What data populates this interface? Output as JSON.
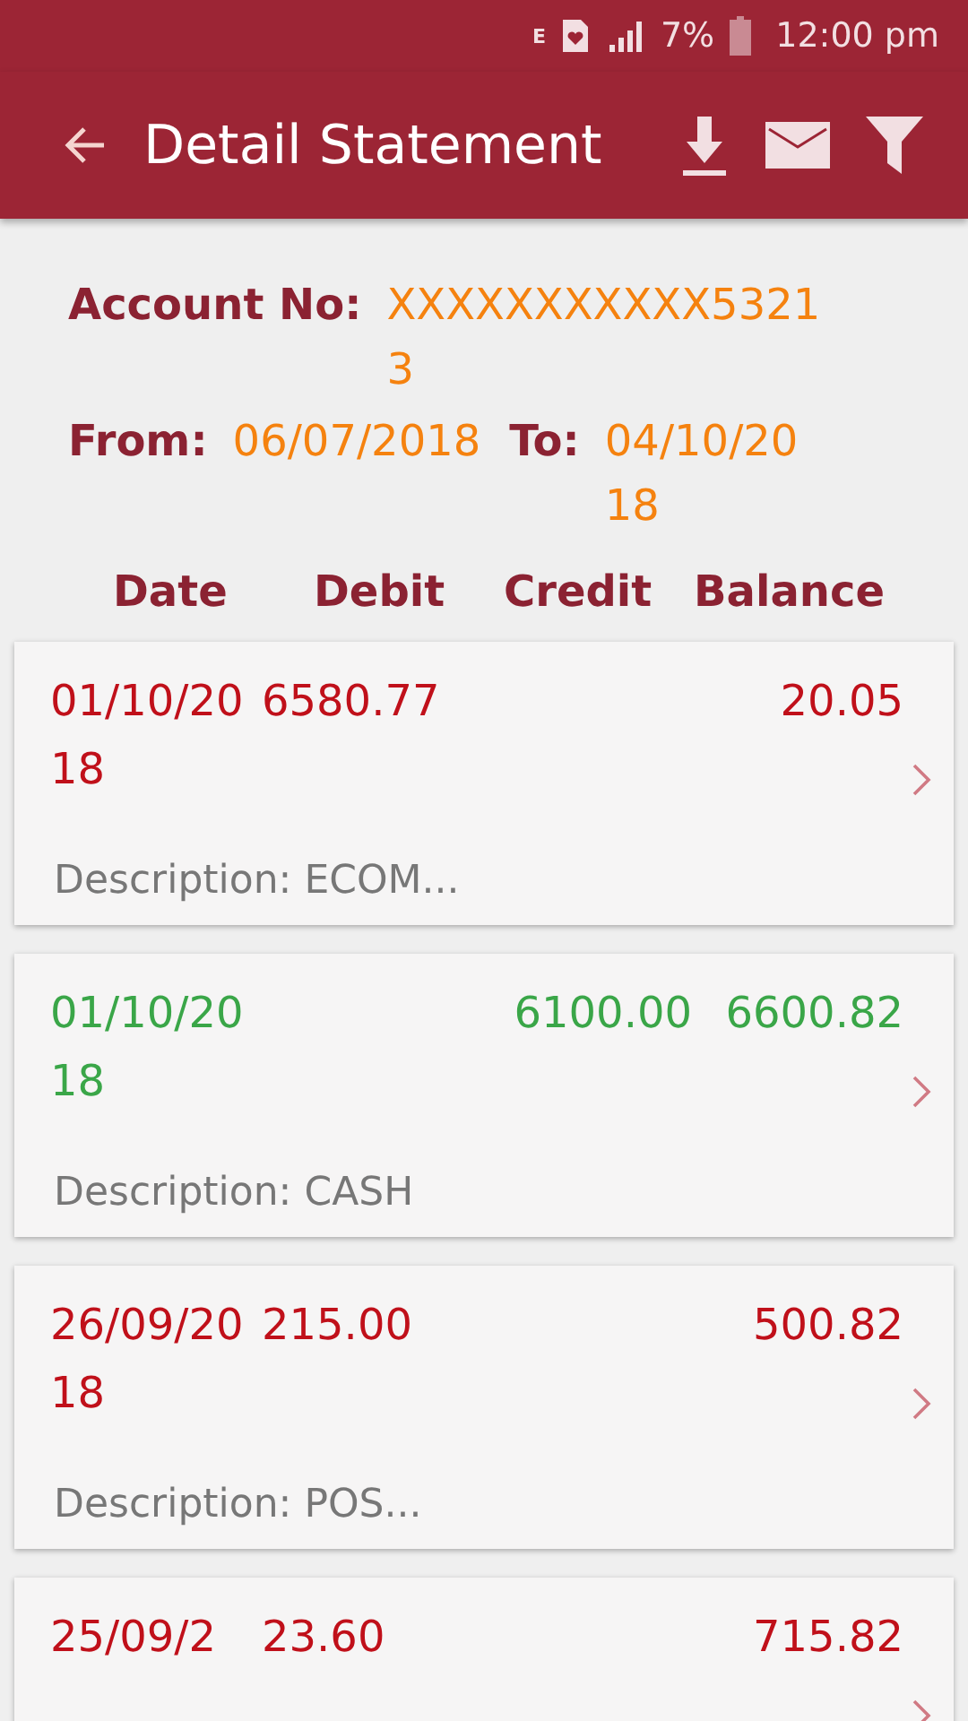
{
  "status_bar": {
    "network": "E",
    "battery": "7%",
    "time": "12:00 pm"
  },
  "app_bar": {
    "title": "Detail Statement"
  },
  "account": {
    "label": "Account No:",
    "value": "XXXXXXXXXXX53213"
  },
  "period": {
    "from_label": "From:",
    "from": "06/07/2018",
    "to_label": "To:",
    "to": "04/10/2018"
  },
  "columns": [
    "Date",
    "Debit",
    "Credit",
    "Balance"
  ],
  "transactions": [
    {
      "kind": "debit",
      "date": "01/10/2018",
      "debit": "6580.77",
      "balance": "20.05",
      "description": "Description: ECOM..."
    },
    {
      "kind": "credit",
      "date": "01/10/2018",
      "credit": "6100.00",
      "balance": "6600.82",
      "description": "Description: CASH"
    },
    {
      "kind": "debit",
      "date": "26/09/2018",
      "debit": "215.00",
      "balance": "500.82",
      "description": "Description: POS..."
    },
    {
      "kind": "debit",
      "date": "25/09/2",
      "debit": "23.60",
      "balance": "715.82"
    }
  ]
}
